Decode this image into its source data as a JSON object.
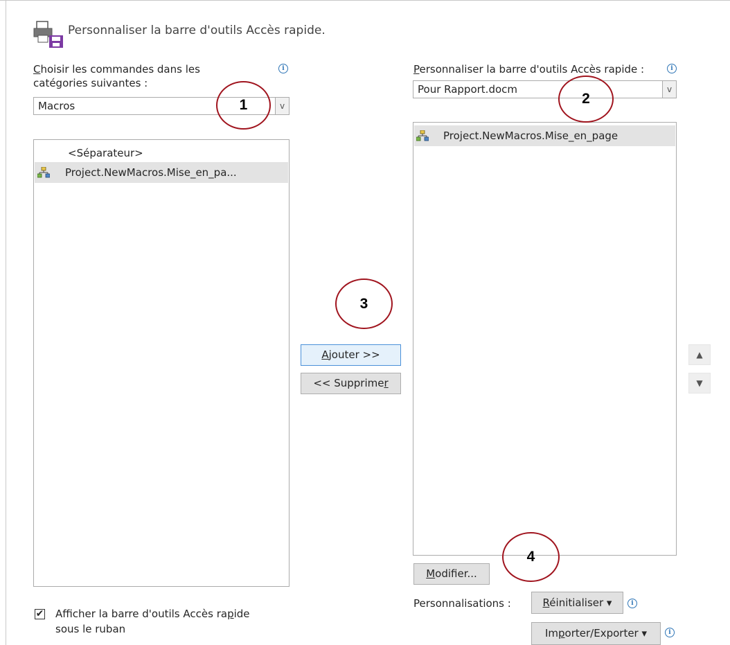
{
  "header": {
    "title": "Personnaliser la barre d'outils Accès rapide.",
    "icon": "quick-access-toolbar-icon"
  },
  "left": {
    "label_line1_access": "C",
    "label_line1_rest": "hoisir les commandes dans les",
    "label_line2": "catégories suivantes :",
    "info": "i",
    "combo_value": "Macros",
    "list_items": [
      {
        "label": "<Séparateur>",
        "icon": ""
      },
      {
        "label": "Project.NewMacros.Mise_en_pa...",
        "icon": "macro-icon",
        "selected": true
      }
    ],
    "checkbox_checked": "✔",
    "checkbox_label_line1_a": "Afficher la barre d'outils Accès ra",
    "checkbox_label_line1_access": "p",
    "checkbox_label_line1_b": "ide",
    "checkbox_label_line2": "sous le ruban"
  },
  "right": {
    "label_access": "P",
    "label_rest": "ersonnaliser la barre d'outils Accès rapide :",
    "info": "i",
    "combo_value": "Pour Rapport.docm",
    "list_items": [
      {
        "label": "Project.NewMacros.Mise_en_page",
        "icon": "macro-icon",
        "selected": true
      }
    ],
    "modify_access": "M",
    "modify_rest": "odifier...",
    "customizations_label": "Personnalisations :",
    "reset_access": "R",
    "reset_rest": "éinitialiser ▾",
    "import_a": "Im",
    "import_access": "p",
    "import_b": "orter/Exporter ▾"
  },
  "middle": {
    "add_access": "A",
    "add_rest": "jouter >>",
    "remove_a": "<< Supprime",
    "remove_access": "r"
  },
  "arrows": {
    "up": "▲",
    "down": "▼",
    "combo": "v"
  },
  "annotations": [
    "1",
    "2",
    "3",
    "4"
  ],
  "colors": {
    "annotation_circle": "#a0141e",
    "selection": "#e3e3e3",
    "info": "#2e75b6"
  }
}
